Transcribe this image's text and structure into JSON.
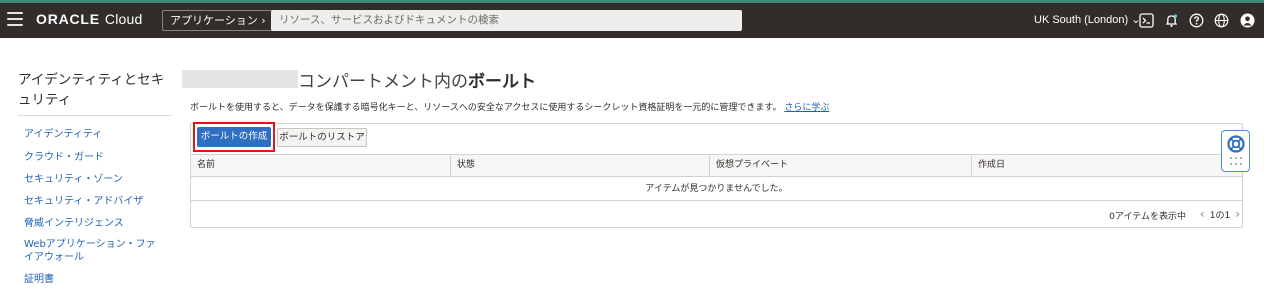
{
  "header": {
    "brand": "ORACLE",
    "product": "Cloud",
    "applications_button": "アプリケーション ›",
    "search_placeholder": "リソース、サービスおよびドキュメントの検索",
    "region": "UK South (London) ⌄",
    "icons": [
      "cloud-shell-icon",
      "bell-icon",
      "help-icon",
      "globe-icon",
      "user-icon"
    ]
  },
  "sidebar": {
    "title": "アイデンティティとセキュリティ",
    "items": [
      {
        "label": "アイデンティティ"
      },
      {
        "label": "クラウド・ガード"
      },
      {
        "label": "セキュリティ・ゾーン"
      },
      {
        "label": "セキュリティ・アドバイザ"
      },
      {
        "label": "脅威インテリジェンス"
      },
      {
        "label": "Webアプリケーション・ファイアウォール"
      },
      {
        "label": "証明書"
      }
    ]
  },
  "main": {
    "title_prefix": "コンパートメント内の",
    "title_bold": "ボールト",
    "description": "ボールトを使用すると、データを保護する暗号化キーと、リソースへの安全なアクセスに使用するシークレット資格証明を一元的に管理できます。",
    "learn_more": "さらに学ぶ",
    "create_button": "ボールトの作成",
    "restore_button": "ボールトのリストア",
    "columns": [
      "名前",
      "状態",
      "仮想プライベート",
      "作成日"
    ],
    "empty_message": "アイテムが見つかりませんでした。",
    "showing_count": "0アイテムを表示中",
    "pagination": "1の1"
  },
  "colors": {
    "header_bg": "#312d2a",
    "link": "#1d63b4",
    "primary_button": "#2f6fc2",
    "highlight_border": "#e21414"
  }
}
